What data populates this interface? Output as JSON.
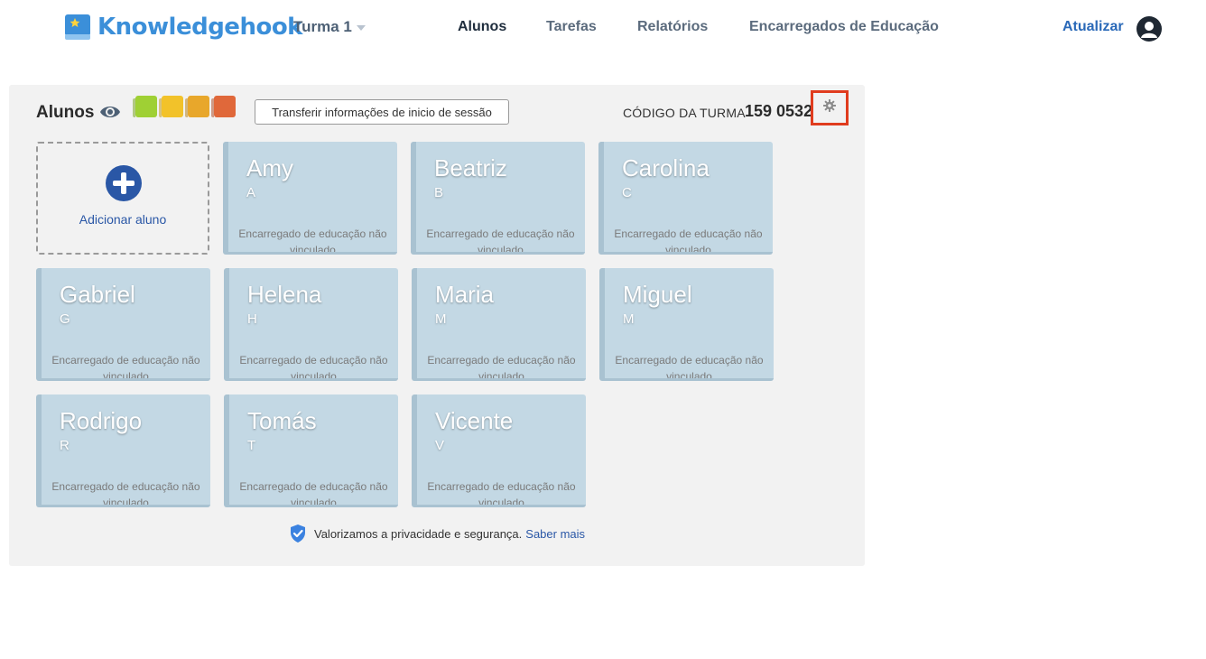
{
  "header": {
    "logo_text": "Knowledgehook",
    "class_select": "Turma 1",
    "nav": [
      {
        "label": "Alunos",
        "active": true
      },
      {
        "label": "Tarefas",
        "active": false
      },
      {
        "label": "Relatórios",
        "active": false
      },
      {
        "label": "Encarregados de Educação",
        "active": false
      }
    ],
    "update_label": "Atualizar"
  },
  "panel": {
    "title": "Alunos",
    "swatch_colors": [
      "#9fd034",
      "#f2c22a",
      "#e8a72b",
      "#e0683a"
    ],
    "transfer_button": "Transferir informações de inicio de sessão",
    "class_code_label": "CÓDIGO DA TURMA",
    "class_code": "159 0532",
    "add_student_label": "Adicionar aluno",
    "students": [
      {
        "name": "Amy",
        "initial": "A",
        "parent": "Encarregado de educação não vinculado"
      },
      {
        "name": "Beatriz",
        "initial": "B",
        "parent": "Encarregado de educação não vinculado"
      },
      {
        "name": "Carolina",
        "initial": "C",
        "parent": "Encarregado de educação não vinculado"
      },
      {
        "name": "Gabriel",
        "initial": "G",
        "parent": "Encarregado de educação não vinculado"
      },
      {
        "name": "Helena",
        "initial": "H",
        "parent": "Encarregado de educação não vinculado"
      },
      {
        "name": "Maria",
        "initial": "M",
        "parent": "Encarregado de educação não vinculado"
      },
      {
        "name": "Miguel",
        "initial": "M",
        "parent": "Encarregado de educação não vinculado"
      },
      {
        "name": "Rodrigo",
        "initial": "R",
        "parent": "Encarregado de educação não vinculado"
      },
      {
        "name": "Tomás",
        "initial": "T",
        "parent": "Encarregado de educação não vinculado"
      },
      {
        "name": "Vicente",
        "initial": "V",
        "parent": "Encarregado de educação não vinculado"
      }
    ],
    "privacy_text": "Valorizamos a privacidade e segurança.",
    "privacy_link": "Saber mais"
  },
  "colors": {
    "brand": "#3b8fd9",
    "card_bg": "#c3d8e4",
    "highlight": "#e03c1e",
    "link": "#2a57a6"
  }
}
